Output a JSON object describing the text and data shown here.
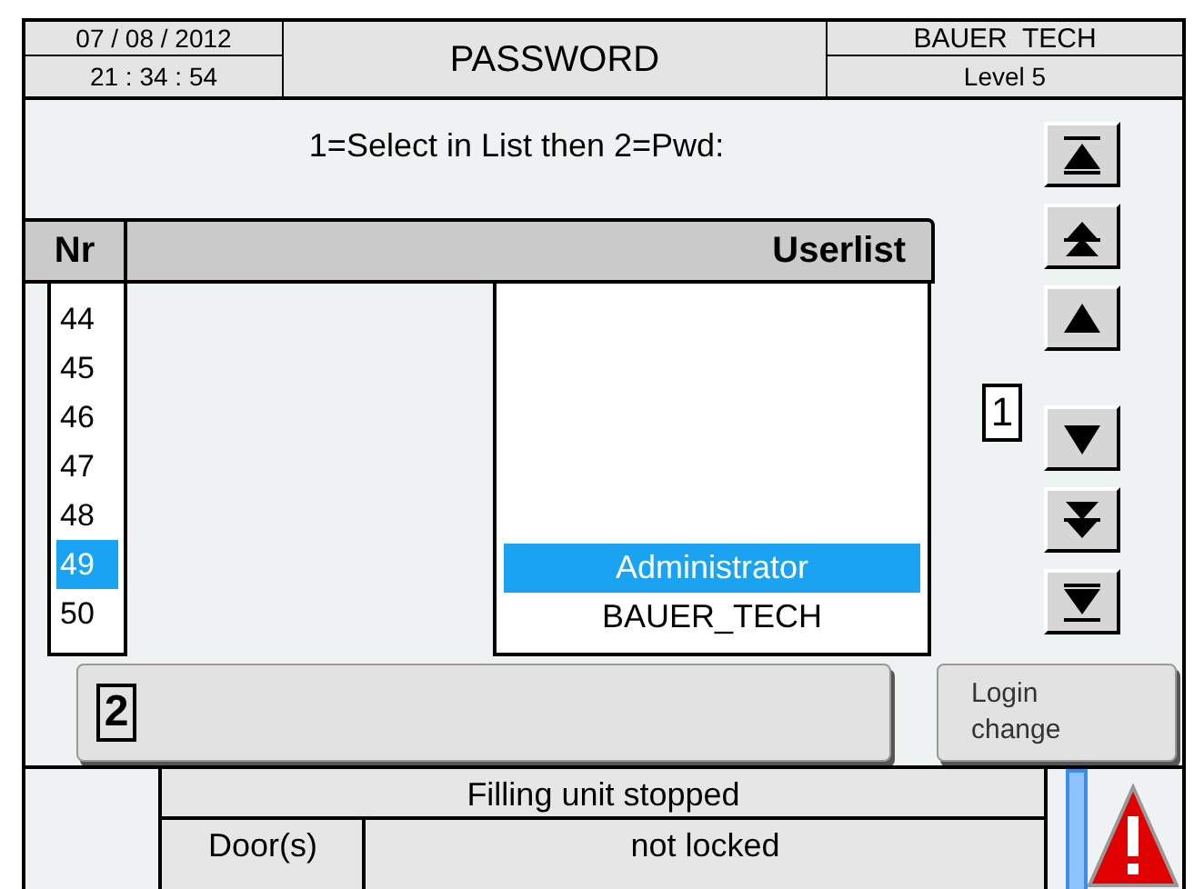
{
  "header": {
    "date": "07 / 08 / 2012",
    "time": "21 : 34 : 54",
    "title": "PASSWORD",
    "company": "BAUER  TECH",
    "level": "Level 5"
  },
  "instruction": "1=Select in List then 2=Pwd:",
  "table": {
    "columns": [
      "Nr",
      "Userlist"
    ],
    "numbers": [
      {
        "text": "44",
        "selected": false
      },
      {
        "text": "45",
        "selected": false
      },
      {
        "text": "46",
        "selected": false
      },
      {
        "text": "47",
        "selected": false
      },
      {
        "text": "48",
        "selected": false
      },
      {
        "text": "49",
        "selected": true
      },
      {
        "text": "50",
        "selected": false
      }
    ],
    "users": [
      {
        "text": "Administrator",
        "selected": true
      },
      {
        "text": "BAUER_TECH",
        "selected": false
      }
    ]
  },
  "scroll_buttons": [
    {
      "kind": "top"
    },
    {
      "kind": "page-up"
    },
    {
      "kind": "up"
    },
    {
      "kind": "down"
    },
    {
      "kind": "page-down"
    },
    {
      "kind": "bottom"
    }
  ],
  "step1_label": "1",
  "password_button": {
    "label": "2"
  },
  "login_button": {
    "label": "Login\nchange"
  },
  "status": {
    "message": "Filling unit stopped",
    "door_label": "Door(s)",
    "door_state": "not locked"
  }
}
